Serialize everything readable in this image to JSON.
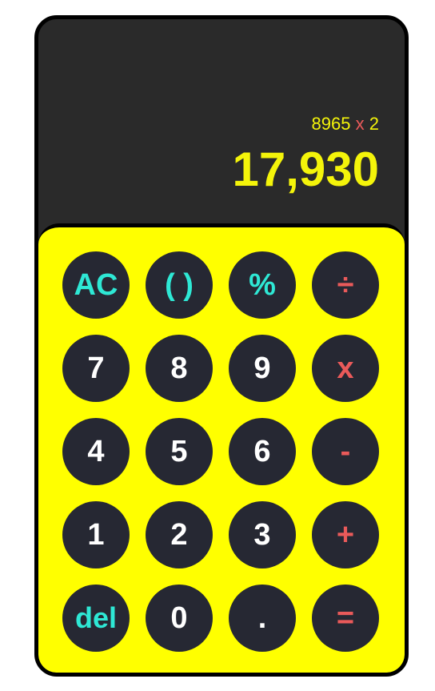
{
  "display": {
    "expression_left": "8965",
    "expression_op": "x",
    "expression_right": "2",
    "result": "17,930"
  },
  "keys": {
    "ac": "AC",
    "parens": "( )",
    "percent": "%",
    "divide": "÷",
    "seven": "7",
    "eight": "8",
    "nine": "9",
    "multiply": "x",
    "four": "4",
    "five": "5",
    "six": "6",
    "minus": "-",
    "one": "1",
    "two": "2",
    "three": "3",
    "plus": "+",
    "del": "del",
    "zero": "0",
    "decimal": ".",
    "equals": "="
  },
  "colors": {
    "keypad_bg": "#ffff00",
    "display_bg": "#2a2a2a",
    "key_bg": "#262833",
    "display_text": "#f4f40a",
    "function_text": "#2ee8d5",
    "operator_text": "#ea5a5a",
    "digit_text": "#ffffff"
  }
}
